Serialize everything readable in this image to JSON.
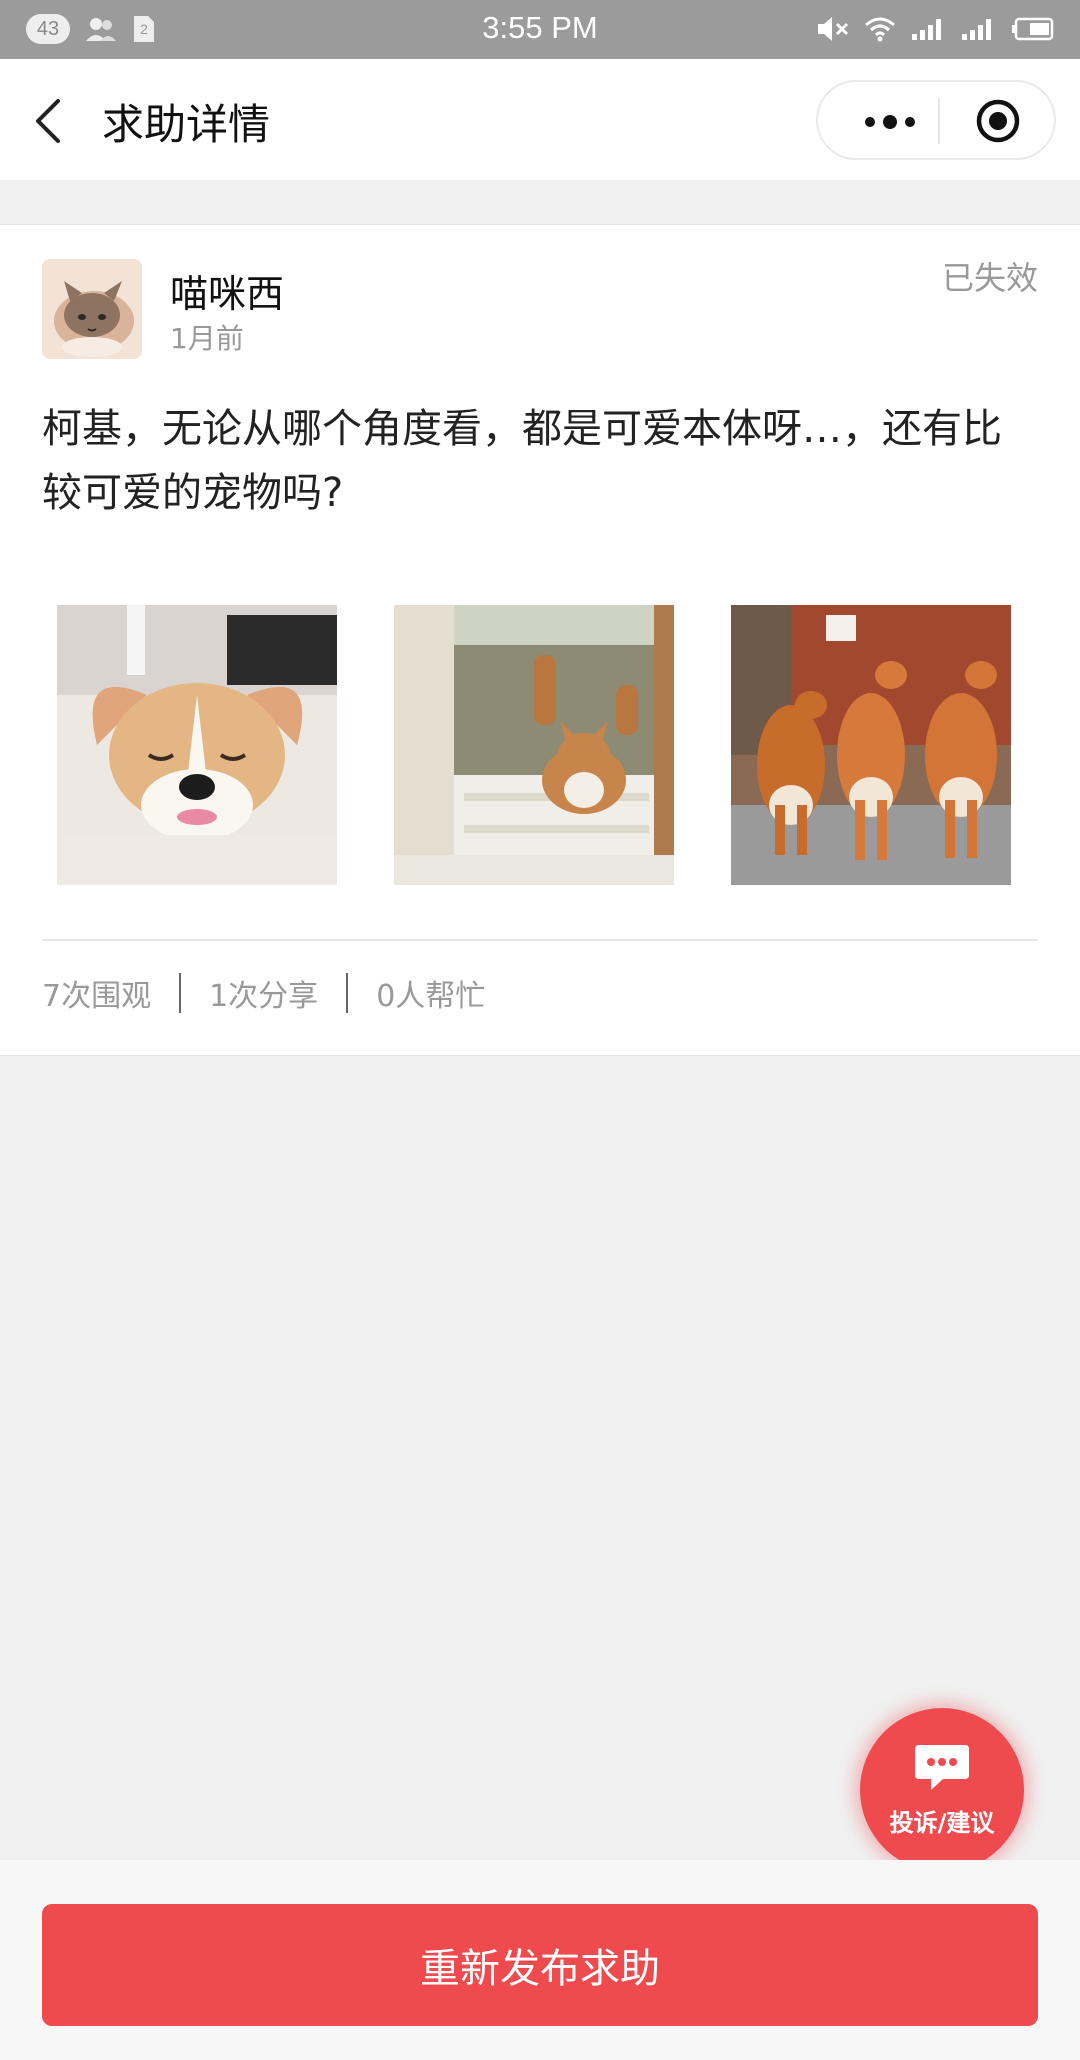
{
  "status_bar": {
    "time": "3:55 PM",
    "notification_count": "43",
    "icons": [
      "contacts-icon",
      "sim-icon",
      "mute-icon",
      "wifi-icon",
      "signal-icon",
      "signal-2-icon",
      "battery-icon"
    ]
  },
  "nav": {
    "title": "求助详情",
    "icons": [
      "back-icon",
      "more-icon",
      "target-icon"
    ]
  },
  "post": {
    "username": "喵咪西",
    "time_ago": "1月前",
    "status": "已失效",
    "content": "柯基，无论从哪个角度看，都是可爱本体呀…，还有比较可爱的宠物吗?",
    "images": [
      "corgi-puppy-sleeping",
      "corgi-jumping",
      "three-corgis"
    ]
  },
  "stats": {
    "views": "7次围观",
    "shares": "1次分享",
    "helpers": "0人帮忙"
  },
  "feedback": {
    "label": "投诉/建议",
    "icon": "chat-bubble-icon"
  },
  "actions": {
    "republish": "重新发布求助"
  },
  "colors": {
    "accent": "#ef4b4f",
    "status_bar": "#9b9b9b",
    "background": "#f0f0f0"
  }
}
